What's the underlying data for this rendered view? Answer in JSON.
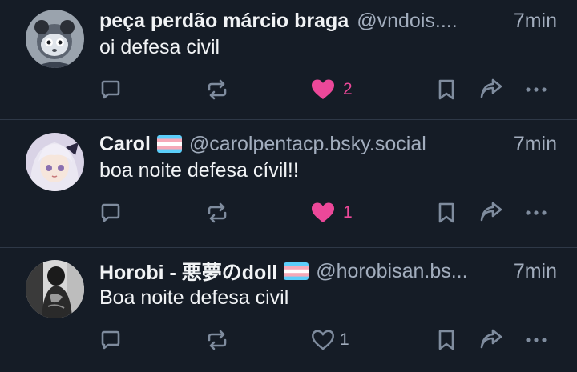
{
  "colors": {
    "background": "#151c26",
    "divider": "#2e3847",
    "text_primary": "#f1f3f5",
    "text_secondary": "#a2adbd",
    "like_active": "#ec4899"
  },
  "posts": [
    {
      "author_name": "peça perdão márcio braga",
      "handle": "@vndois....",
      "time": "7min",
      "text": "oi defesa civil",
      "has_flag": false,
      "liked": true,
      "like_count": "2",
      "avatar": "avatar-bear-plush"
    },
    {
      "author_name": "Carol",
      "handle": "@carolpentacp.bsky.social",
      "time": "7min",
      "text": "boa noite defesa cívil!!",
      "has_flag": true,
      "flag": "transgender-flag",
      "liked": true,
      "like_count": "1",
      "avatar": "avatar-anime-girl"
    },
    {
      "author_name": "Horobi - 悪夢のdoll",
      "handle": "@horobisan.bs...",
      "time": "7min",
      "text": "Boa noite defesa civil",
      "has_flag": true,
      "flag": "transgender-flag",
      "liked": false,
      "like_count": "1",
      "avatar": "avatar-bw-photo"
    }
  ],
  "icons": {
    "reply": "reply-icon",
    "repost": "repost-icon",
    "like": "heart-icon",
    "save": "bookmark-icon",
    "share": "share-icon",
    "more": "more-icon"
  }
}
